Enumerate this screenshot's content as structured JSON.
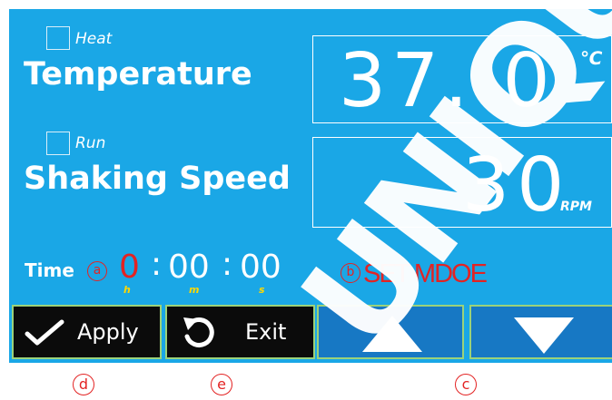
{
  "heat": {
    "checkbox_label": "Heat",
    "label": "Temperature",
    "value": "37. 0",
    "unit": "℃"
  },
  "run": {
    "checkbox_label": "Run",
    "label": "Shaking Speed",
    "value": "30",
    "unit": "RPM"
  },
  "time": {
    "label": "Time",
    "hours": "0",
    "minutes": "00",
    "seconds": "00",
    "sep": ":",
    "h_unit": "h",
    "m_unit": "m",
    "s_unit": "s"
  },
  "mode_text": "SET MDOE",
  "buttons": {
    "apply": "Apply",
    "exit": "Exit"
  },
  "annotations": {
    "a": "a",
    "b": "b",
    "c": "c",
    "d": "d",
    "e": "e"
  },
  "watermark": "UNIQUE",
  "colors": {
    "screen_bg": "#1aa7e6",
    "accent_red": "#e32323",
    "unit_yellow": "#ffd800",
    "button_dark": "#0b0b0b",
    "button_blue": "#1778c4"
  },
  "icons": {
    "apply": "check-icon",
    "exit": "undo-icon",
    "up": "triangle-up-icon",
    "down": "triangle-down-icon"
  }
}
